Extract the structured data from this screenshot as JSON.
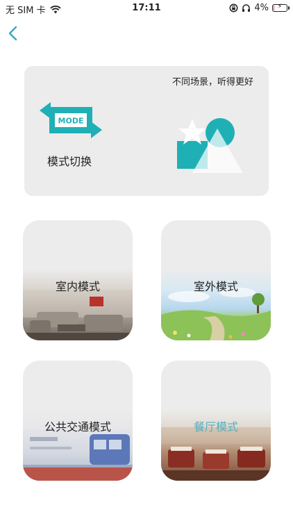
{
  "status_bar": {
    "carrier": "无 SIM 卡",
    "time": "17:11",
    "battery_percent": "4%",
    "battery_level": 0.04
  },
  "hero": {
    "slogan": "不同场景，听得更好",
    "icon_text": "MODE",
    "label": "模式切换"
  },
  "modes": [
    {
      "label": "室内模式",
      "active": false
    },
    {
      "label": "室外模式",
      "active": false
    },
    {
      "label": "公共交通模式",
      "active": false
    },
    {
      "label": "餐厅模式",
      "active": true
    }
  ],
  "colors": {
    "accent": "#1fb0b6",
    "active_label": "#4fb0bf",
    "card_bg": "#ececec"
  }
}
